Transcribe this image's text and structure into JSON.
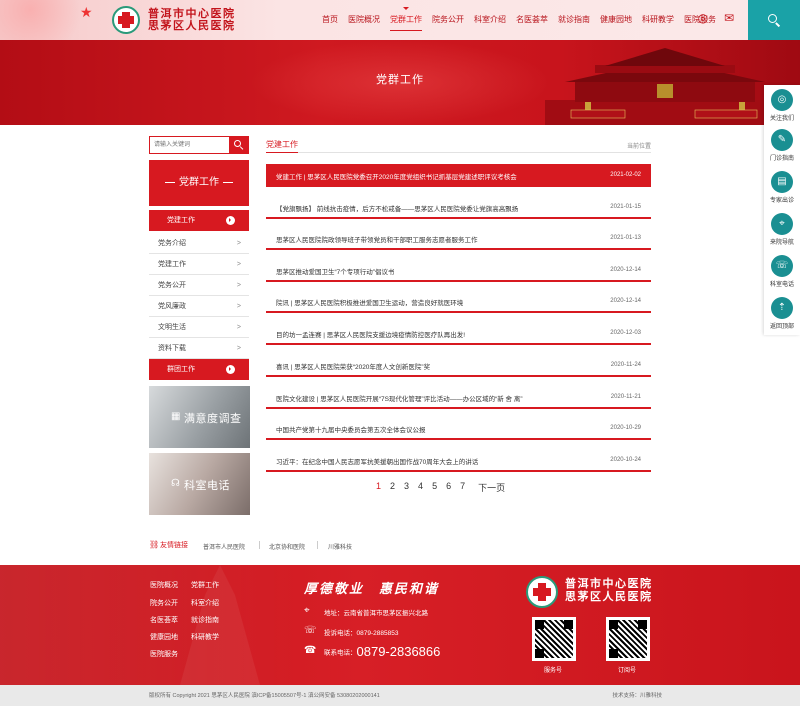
{
  "header": {
    "hospital_name_line1": "普洱市中心医院",
    "hospital_name_line2": "思茅区人民医院",
    "nav": [
      "首页",
      "医院概况",
      "党群工作",
      "院务公开",
      "科室介绍",
      "名医荟萃",
      "就诊指南",
      "健康园地",
      "科研教学",
      "医院服务"
    ],
    "active_nav": "党群工作",
    "icons": [
      "wechat-icon",
      "mail-icon",
      "search-icon"
    ]
  },
  "banner": {
    "title": "党群工作"
  },
  "float_bar": {
    "items": [
      {
        "label": "关注我们",
        "icon": "wechat-icon"
      },
      {
        "label": "门诊指南",
        "icon": "chat-icon"
      },
      {
        "label": "专家出诊",
        "icon": "calendar-icon"
      },
      {
        "label": "来院导航",
        "icon": "location-icon"
      },
      {
        "label": "科室电话",
        "icon": "phone-icon"
      },
      {
        "label": "返回顶部",
        "icon": "arrow-up-icon"
      }
    ]
  },
  "sidebar": {
    "search_placeholder": "请输入关键词",
    "title": "党群工作",
    "menu": [
      {
        "label": "党建工作",
        "active": true
      },
      {
        "label": "党务介绍",
        "active": false
      },
      {
        "label": "党建工作",
        "active": false
      },
      {
        "label": "党务公开",
        "active": false
      },
      {
        "label": "党风廉政",
        "active": false
      },
      {
        "label": "文明生活",
        "active": false
      },
      {
        "label": "资料下载",
        "active": false
      },
      {
        "label": "群团工作",
        "active": true
      }
    ],
    "arrow": ">",
    "promos": [
      "满意度调查",
      "科室电话"
    ]
  },
  "main": {
    "section_title": "党建工作",
    "breadcrumb": "当前位置",
    "news": [
      {
        "title": "党建工作 | 思茅区人民医院党委召开2020年度党组织书记抓基层党建述职评议考核会",
        "date": "2021-02-02"
      },
      {
        "title": "【党旗飘扬】 前线抗击疫情，后方不松戒备——思茅区人民医院党委让党旗高高飘扬",
        "date": "2021-01-15"
      },
      {
        "title": "思茅区人民医院院政领导班子带领党员和干部职工服务志愿者服务工作",
        "date": "2021-01-13"
      },
      {
        "title": "思茅区推动爱国卫生“7个专项行动”倡议书",
        "date": "2020-12-14"
      },
      {
        "title": "院讯 | 思茅区人民医院积极推进爱国卫生运动，营造良好就医环境",
        "date": "2020-12-14"
      },
      {
        "title": "目的坊一孟连赛 | 思茅区人民医院支援边境疫情防控医疗队再出发!",
        "date": "2020-12-03"
      },
      {
        "title": "喜讯 | 思茅区人民医院荣获“2020年度人文创新医院”奖",
        "date": "2020-11-24"
      },
      {
        "title": "医院文化建设 | 思茅区人民医院开展“7S现代化管理”评比活动——办公区域的“新 舍 离”",
        "date": "2020-11-21"
      },
      {
        "title": "中国共产党第十九届中央委员会第五次全体会议公报",
        "date": "2020-10-29"
      },
      {
        "title": "习近平：在纪念中国人民志愿军抗美援朝出国作战70周年大会上的讲话",
        "date": "2020-10-24"
      }
    ],
    "pager": {
      "pages": [
        "1",
        "2",
        "3",
        "4",
        "5",
        "6",
        "7"
      ],
      "current": "1",
      "next": "下一页"
    }
  },
  "links": {
    "heading": "友情链接",
    "items": [
      "普洱市人民医院",
      "北京协和医院",
      "川雅科技"
    ]
  },
  "footer": {
    "nav": [
      "医院概况",
      "党群工作",
      "院务公开",
      "科室介绍",
      "名医荟萃",
      "就诊指南",
      "健康园地",
      "科研教学",
      "医院服务"
    ],
    "slogan": "厚德敬业　惠民和谐",
    "address_label": "地址：",
    "address": "云南省普洱市思茅区振兴北路",
    "report_label": "投诉电话：",
    "report_phone": "0879-2885853",
    "contact_label": "联系电话：",
    "contact_phone": "0879-2836866",
    "name_line1": "普洱市中心医院",
    "name_line2": "思茅区人民医院",
    "qr_labels": [
      "服务号",
      "订阅号"
    ],
    "copyright": "版权所有 Copyright 2021 思茅区人民医院  滇ICP备15005507号-1  滇公网安备 53080202000141",
    "tech": "技术支持：川雅科技"
  }
}
